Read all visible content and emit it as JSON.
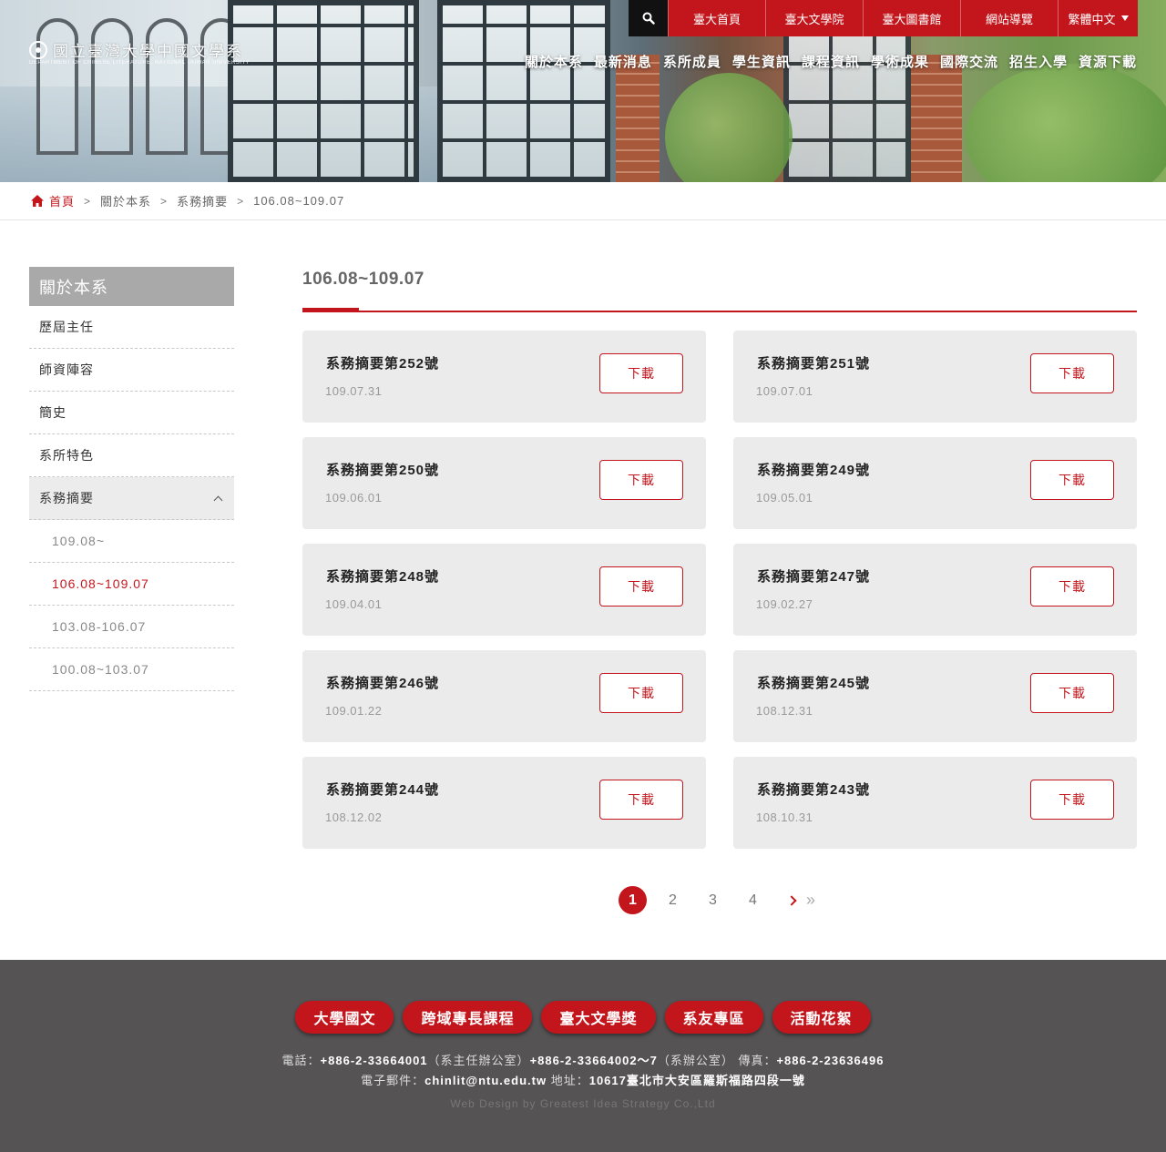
{
  "header": {
    "logo_text": "國立臺灣大學中國文學系",
    "logo_subtitle": "DEPARTMENT OF CHINESE LITERATURE, NATIONAL TAIWAN UNIVERSITY",
    "top_links": [
      "臺大首頁",
      "臺大文學院",
      "臺大圖書館",
      "網站導覽"
    ],
    "language": "繁體中文",
    "nav": [
      "關於本系",
      "最新消息",
      "系所成員",
      "學生資訊",
      "課程資訊",
      "學術成果",
      "國際交流",
      "招生入學",
      "資源下載"
    ]
  },
  "breadcrumb": {
    "home": "首頁",
    "items": [
      "關於本系",
      "系務摘要",
      "106.08~109.07"
    ]
  },
  "sidebar": {
    "title": "關於本系",
    "items": [
      "歷屆主任",
      "師資陣容",
      "簡史",
      "系所特色"
    ],
    "open_item": "系務摘要",
    "sub_items": [
      "109.08~",
      "106.08~109.07",
      "103.08-106.07",
      "100.08~103.07"
    ],
    "active_sub": "106.08~109.07"
  },
  "main": {
    "title": "106.08~109.07",
    "download_label": "下載",
    "cards": [
      {
        "title": "系務摘要第252號",
        "date": "109.07.31"
      },
      {
        "title": "系務摘要第251號",
        "date": "109.07.01"
      },
      {
        "title": "系務摘要第250號",
        "date": "109.06.01"
      },
      {
        "title": "系務摘要第249號",
        "date": "109.05.01"
      },
      {
        "title": "系務摘要第248號",
        "date": "109.04.01"
      },
      {
        "title": "系務摘要第247號",
        "date": "109.02.27"
      },
      {
        "title": "系務摘要第246號",
        "date": "109.01.22"
      },
      {
        "title": "系務摘要第245號",
        "date": "108.12.31"
      },
      {
        "title": "系務摘要第244號",
        "date": "108.12.02"
      },
      {
        "title": "系務摘要第243號",
        "date": "108.10.31"
      }
    ]
  },
  "pagination": {
    "pages": [
      "1",
      "2",
      "3",
      "4"
    ],
    "current": "1",
    "last_label": "»"
  },
  "footer": {
    "links": [
      "大學國文",
      "跨域專長課程",
      "臺大文學獎",
      "系友專區",
      "活動花絮"
    ],
    "phone_label": "電話：",
    "phone_1": "+886-2-33664001",
    "phone_1_note": "（系主任辦公室）",
    "phone_2": "+886-2-33664002～7",
    "phone_2_note": "（系辦公室）",
    "fax_label": "傳真：",
    "fax": "+886-2-23636496",
    "email_label": "電子郵件：",
    "email": "chinlit@ntu.edu.tw",
    "address_label": "地址：",
    "address": "10617臺北市大安區羅斯福路四段一號",
    "credit": "Web Design by Greatest Idea Strategy Co.,Ltd"
  },
  "colors": {
    "accent": "#c3161c",
    "footer_bg": "#555354",
    "card_bg": "#ebebeb",
    "sidebar_title_bg": "#a9a9a9"
  }
}
